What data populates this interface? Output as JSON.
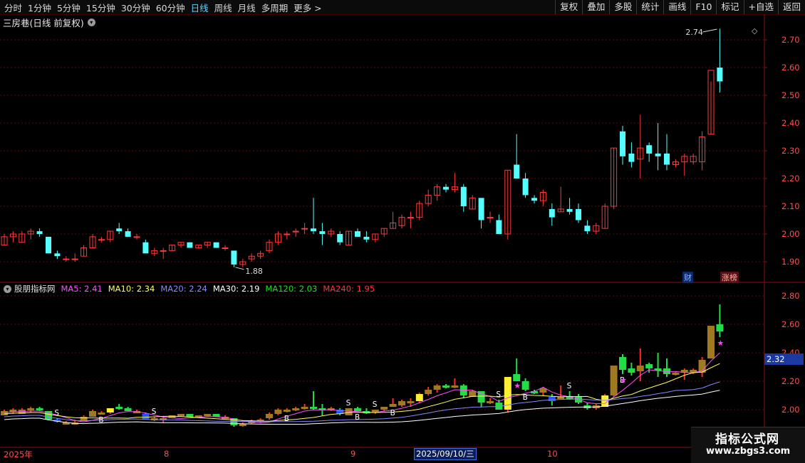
{
  "toolbar": {
    "periods": [
      "分时",
      "1分钟",
      "5分钟",
      "15分钟",
      "30分钟",
      "60分钟",
      "日线",
      "周线",
      "月线",
      "多周期",
      "更多 >"
    ],
    "active_period": "日线",
    "buttons": [
      "复权",
      "叠加",
      "多股",
      "统计",
      "画线",
      "F10",
      "标记",
      "+自选",
      "返回"
    ]
  },
  "main_title": "三房巷(日线 前复权)",
  "main_title_icon": "chevron-down-icon",
  "high_label": "2.74",
  "low_label": "1.88",
  "main_axis": [
    "2.70",
    "2.60",
    "2.50",
    "2.40",
    "2.30",
    "2.20",
    "2.10",
    "2.00",
    "1.90"
  ],
  "tags": {
    "cai": "财",
    "zhangbang": "涨榜"
  },
  "indicator": {
    "name": "股朋指标网",
    "ma": [
      {
        "label": "MA5: 2.41",
        "color": "#ff4dff"
      },
      {
        "label": "MA10: 2.34",
        "color": "#ffff55"
      },
      {
        "label": "MA20: 2.24",
        "color": "#8888ff"
      },
      {
        "label": "MA30: 2.19",
        "color": "#ffffff"
      },
      {
        "label": "MA120: 2.03",
        "color": "#22dd22"
      },
      {
        "label": "MA240: 1.95",
        "color": "#ff3333"
      }
    ]
  },
  "ind_axis": [
    "2.80",
    "2.60",
    "2.40",
    "2.20",
    "2.00"
  ],
  "current_price": "2.32",
  "dates": {
    "y2025": "2025年",
    "m8": "8",
    "m9": "9",
    "selected": "2025/09/10/三",
    "m10": "10"
  },
  "watermark": {
    "cn": "指标公式网",
    "url": "www.zbgs3.com"
  },
  "chart_data": {
    "type": "candlestick",
    "series": [
      {
        "o": 1.96,
        "h": 2.0,
        "l": 1.96,
        "c": 1.99
      },
      {
        "o": 1.99,
        "h": 2.01,
        "l": 1.97,
        "c": 2.0
      },
      {
        "o": 1.97,
        "h": 2.01,
        "l": 1.97,
        "c": 2.0
      },
      {
        "o": 2.0,
        "h": 2.02,
        "l": 1.98,
        "c": 2.01
      },
      {
        "o": 2.01,
        "h": 2.02,
        "l": 1.99,
        "c": 2.0
      },
      {
        "o": 1.99,
        "h": 1.99,
        "l": 1.93,
        "c": 1.93
      },
      {
        "o": 1.93,
        "h": 1.94,
        "l": 1.91,
        "c": 1.92
      },
      {
        "o": 1.91,
        "h": 1.92,
        "l": 1.9,
        "c": 1.91
      },
      {
        "o": 1.91,
        "h": 1.93,
        "l": 1.9,
        "c": 1.91
      },
      {
        "o": 1.92,
        "h": 1.96,
        "l": 1.92,
        "c": 1.95
      },
      {
        "o": 1.95,
        "h": 2.0,
        "l": 1.95,
        "c": 1.99
      },
      {
        "o": 1.98,
        "h": 1.99,
        "l": 1.97,
        "c": 1.98
      },
      {
        "o": 1.98,
        "h": 2.01,
        "l": 1.97,
        "c": 2.01
      },
      {
        "o": 2.02,
        "h": 2.04,
        "l": 2.0,
        "c": 2.01
      },
      {
        "o": 2.01,
        "h": 2.02,
        "l": 1.99,
        "c": 1.99
      },
      {
        "o": 1.99,
        "h": 2.0,
        "l": 1.98,
        "c": 1.99
      },
      {
        "o": 1.97,
        "h": 1.98,
        "l": 1.93,
        "c": 1.93
      },
      {
        "o": 1.93,
        "h": 1.95,
        "l": 1.92,
        "c": 1.94
      },
      {
        "o": 1.94,
        "h": 1.95,
        "l": 1.91,
        "c": 1.94
      },
      {
        "o": 1.94,
        "h": 1.96,
        "l": 1.94,
        "c": 1.96
      },
      {
        "o": 1.96,
        "h": 1.97,
        "l": 1.95,
        "c": 1.97
      },
      {
        "o": 1.97,
        "h": 1.97,
        "l": 1.95,
        "c": 1.95
      },
      {
        "o": 1.95,
        "h": 1.96,
        "l": 1.95,
        "c": 1.96
      },
      {
        "o": 1.96,
        "h": 1.97,
        "l": 1.95,
        "c": 1.97
      },
      {
        "o": 1.97,
        "h": 1.97,
        "l": 1.95,
        "c": 1.95
      },
      {
        "o": 1.95,
        "h": 1.96,
        "l": 1.94,
        "c": 1.95
      },
      {
        "o": 1.94,
        "h": 1.94,
        "l": 1.88,
        "c": 1.89
      },
      {
        "o": 1.89,
        "h": 1.91,
        "l": 1.88,
        "c": 1.9
      },
      {
        "o": 1.91,
        "h": 1.93,
        "l": 1.9,
        "c": 1.92
      },
      {
        "o": 1.92,
        "h": 1.94,
        "l": 1.91,
        "c": 1.93
      },
      {
        "o": 1.94,
        "h": 1.98,
        "l": 1.93,
        "c": 1.97
      },
      {
        "o": 1.97,
        "h": 2.01,
        "l": 1.96,
        "c": 2.0
      },
      {
        "o": 2.0,
        "h": 2.01,
        "l": 1.98,
        "c": 2.0
      },
      {
        "o": 2.01,
        "h": 2.02,
        "l": 1.99,
        "c": 2.01
      },
      {
        "o": 2.02,
        "h": 2.04,
        "l": 2.0,
        "c": 2.02
      },
      {
        "o": 2.02,
        "h": 2.13,
        "l": 2.0,
        "c": 2.01
      },
      {
        "o": 2.01,
        "h": 2.04,
        "l": 1.96,
        "c": 2.0
      },
      {
        "o": 2.0,
        "h": 2.02,
        "l": 1.99,
        "c": 2.01
      },
      {
        "o": 2.0,
        "h": 2.01,
        "l": 1.96,
        "c": 1.97
      },
      {
        "o": 1.96,
        "h": 2.01,
        "l": 1.96,
        "c": 2.01
      },
      {
        "o": 2.01,
        "h": 2.02,
        "l": 1.99,
        "c": 1.99
      },
      {
        "o": 1.99,
        "h": 2.01,
        "l": 1.97,
        "c": 1.98
      },
      {
        "o": 1.98,
        "h": 2.0,
        "l": 1.97,
        "c": 2.0
      },
      {
        "o": 2.0,
        "h": 2.02,
        "l": 1.99,
        "c": 2.02
      },
      {
        "o": 2.02,
        "h": 2.08,
        "l": 2.02,
        "c": 2.04
      },
      {
        "o": 2.03,
        "h": 2.07,
        "l": 2.02,
        "c": 2.06
      },
      {
        "o": 2.06,
        "h": 2.08,
        "l": 2.02,
        "c": 2.06
      },
      {
        "o": 2.06,
        "h": 2.12,
        "l": 2.05,
        "c": 2.11
      },
      {
        "o": 2.11,
        "h": 2.16,
        "l": 2.1,
        "c": 2.14
      },
      {
        "o": 2.14,
        "h": 2.18,
        "l": 2.12,
        "c": 2.17
      },
      {
        "o": 2.17,
        "h": 2.18,
        "l": 2.15,
        "c": 2.16
      },
      {
        "o": 2.16,
        "h": 2.22,
        "l": 2.15,
        "c": 2.17
      },
      {
        "o": 2.17,
        "h": 2.18,
        "l": 2.08,
        "c": 2.1
      },
      {
        "o": 2.09,
        "h": 2.14,
        "l": 2.09,
        "c": 2.13
      },
      {
        "o": 2.13,
        "h": 2.13,
        "l": 2.02,
        "c": 2.05
      },
      {
        "o": 2.06,
        "h": 2.08,
        "l": 2.04,
        "c": 2.06
      },
      {
        "o": 2.05,
        "h": 2.07,
        "l": 2.0,
        "c": 2.0
      },
      {
        "o": 2.0,
        "h": 2.23,
        "l": 1.98,
        "c": 2.23
      },
      {
        "o": 2.25,
        "h": 2.36,
        "l": 2.21,
        "c": 2.2
      },
      {
        "o": 2.2,
        "h": 2.22,
        "l": 2.13,
        "c": 2.14
      },
      {
        "o": 2.13,
        "h": 2.14,
        "l": 2.11,
        "c": 2.12
      },
      {
        "o": 2.12,
        "h": 2.16,
        "l": 2.1,
        "c": 2.15
      },
      {
        "o": 2.09,
        "h": 2.11,
        "l": 2.03,
        "c": 2.06
      },
      {
        "o": 2.08,
        "h": 2.17,
        "l": 2.08,
        "c": 2.09
      },
      {
        "o": 2.09,
        "h": 2.13,
        "l": 2.07,
        "c": 2.08
      },
      {
        "o": 2.09,
        "h": 2.11,
        "l": 2.04,
        "c": 2.05
      },
      {
        "o": 2.03,
        "h": 2.05,
        "l": 2.0,
        "c": 2.01
      },
      {
        "o": 2.01,
        "h": 2.04,
        "l": 2.0,
        "c": 2.03
      },
      {
        "o": 2.02,
        "h": 2.11,
        "l": 2.02,
        "c": 2.1
      },
      {
        "o": 2.1,
        "h": 2.31,
        "l": 2.09,
        "c": 2.31
      },
      {
        "o": 2.37,
        "h": 2.39,
        "l": 2.25,
        "c": 2.28
      },
      {
        "o": 2.29,
        "h": 2.33,
        "l": 2.24,
        "c": 2.26
      },
      {
        "o": 2.27,
        "h": 2.43,
        "l": 2.2,
        "c": 2.31
      },
      {
        "o": 2.32,
        "h": 2.33,
        "l": 2.26,
        "c": 2.29
      },
      {
        "o": 2.29,
        "h": 2.4,
        "l": 2.23,
        "c": 2.28
      },
      {
        "o": 2.29,
        "h": 2.36,
        "l": 2.23,
        "c": 2.25
      },
      {
        "o": 2.25,
        "h": 2.27,
        "l": 2.24,
        "c": 2.26
      },
      {
        "o": 2.26,
        "h": 2.29,
        "l": 2.21,
        "c": 2.28
      },
      {
        "o": 2.26,
        "h": 2.29,
        "l": 2.25,
        "c": 2.28
      },
      {
        "o": 2.26,
        "h": 2.37,
        "l": 2.23,
        "c": 2.35
      },
      {
        "o": 2.36,
        "h": 2.55,
        "l": 2.36,
        "c": 2.59
      },
      {
        "o": 2.6,
        "h": 2.74,
        "l": 2.51,
        "c": 2.55
      }
    ]
  }
}
